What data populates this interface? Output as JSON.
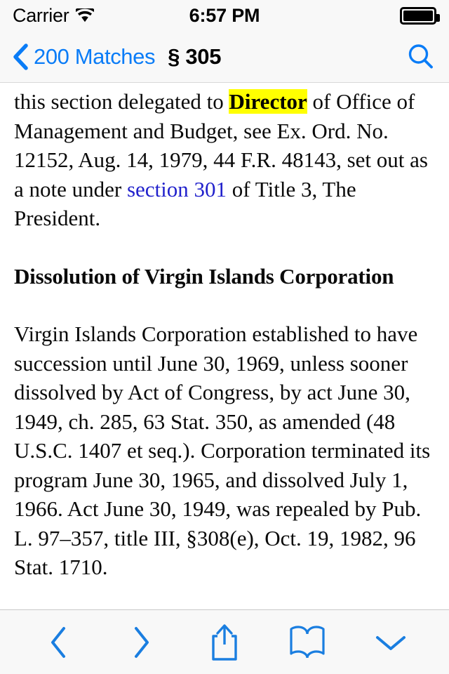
{
  "status_bar": {
    "carrier": "Carrier",
    "wifi_icon": "wifi-icon",
    "time": "6:57 PM",
    "battery_icon": "battery-full-icon"
  },
  "nav_bar": {
    "back_icon": "chevron-left-icon",
    "back_label": "200 Matches",
    "title": "§ 305",
    "search_icon": "search-icon"
  },
  "document": {
    "note_paragraph": {
      "before_highlight": "this section delegated to ",
      "highlight": "Director",
      "after_highlight": " of Office of Management and Budget, see Ex. Ord. No. 12152, Aug. 14, 1979, 44 F.R. 48143, set out as a note under ",
      "link": "section 301",
      "after_link": " of Title 3, The President."
    },
    "heading": "Dissolution of Virgin Islands Corporation",
    "body_paragraph": "Virgin Islands Corporation established to have succession until June 30, 1969, unless sooner dissolved by Act of Congress, by act June 30, 1949, ch. 285, 63 Stat. 350, as amended (48 U.S.C. 1407 et seq.). Corporation terminated its program June 30, 1965, and dissolved July 1, 1966. Act June 30, 1949, was repealed by Pub. L. 97–357, title III, §308(e), Oct. 19, 1982, 96 Stat. 1710."
  },
  "toolbar": {
    "items": [
      {
        "name": "previous-button",
        "icon": "chevron-left-icon"
      },
      {
        "name": "next-button",
        "icon": "chevron-right-icon"
      },
      {
        "name": "share-button",
        "icon": "share-icon"
      },
      {
        "name": "bookmark-button",
        "icon": "book-icon"
      },
      {
        "name": "more-button",
        "icon": "chevron-down-icon"
      }
    ]
  },
  "colors": {
    "accent": "#0a7cf7",
    "link": "#2222cc",
    "highlight": "#ffff00",
    "bar_background": "#f8f8f8",
    "content_background": "#ffffff"
  }
}
